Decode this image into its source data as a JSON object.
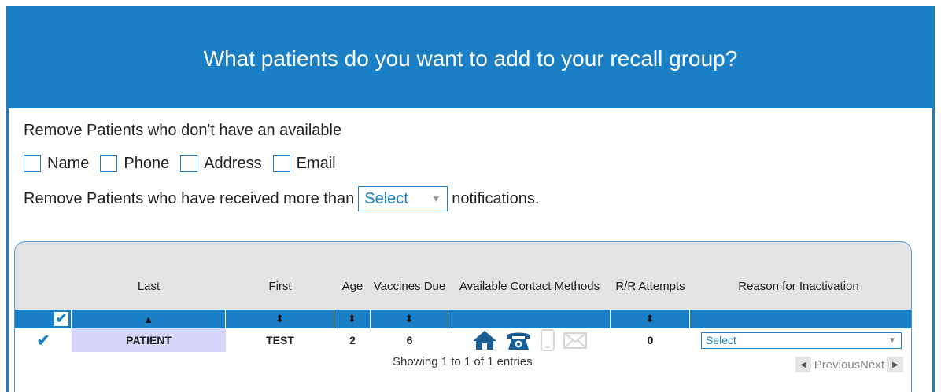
{
  "header": {
    "title": "What patients do you want to add to your recall group?"
  },
  "filters": {
    "line1": "Remove Patients who don't have an available",
    "options": [
      {
        "label": "Name",
        "checked": false
      },
      {
        "label": "Phone",
        "checked": false
      },
      {
        "label": "Address",
        "checked": false
      },
      {
        "label": "Email",
        "checked": false
      }
    ],
    "line3_prefix": "Remove Patients who have received more than",
    "line3_select": "Select",
    "line3_suffix": "notifications."
  },
  "table": {
    "columns": [
      "Last",
      "First",
      "Age",
      "Vaccines Due",
      "Available Contact Methods",
      "R/R Attempts",
      "Reason for Inactivation"
    ],
    "rows": [
      {
        "checked": true,
        "last": "PATIENT",
        "first": "TEST",
        "age": "2",
        "vaccines_due": "6",
        "rr_attempts": "0",
        "reason": "Select",
        "contact_icons": [
          "home-icon",
          "phone-icon",
          "mobile-icon",
          "email-icon"
        ]
      }
    ],
    "showing": "Showing 1 to 1 of 1 entries",
    "previous": "Previous",
    "next": "Next"
  },
  "colors": {
    "accent": "#1a7fc4",
    "highlight": "#d7d7fb"
  }
}
